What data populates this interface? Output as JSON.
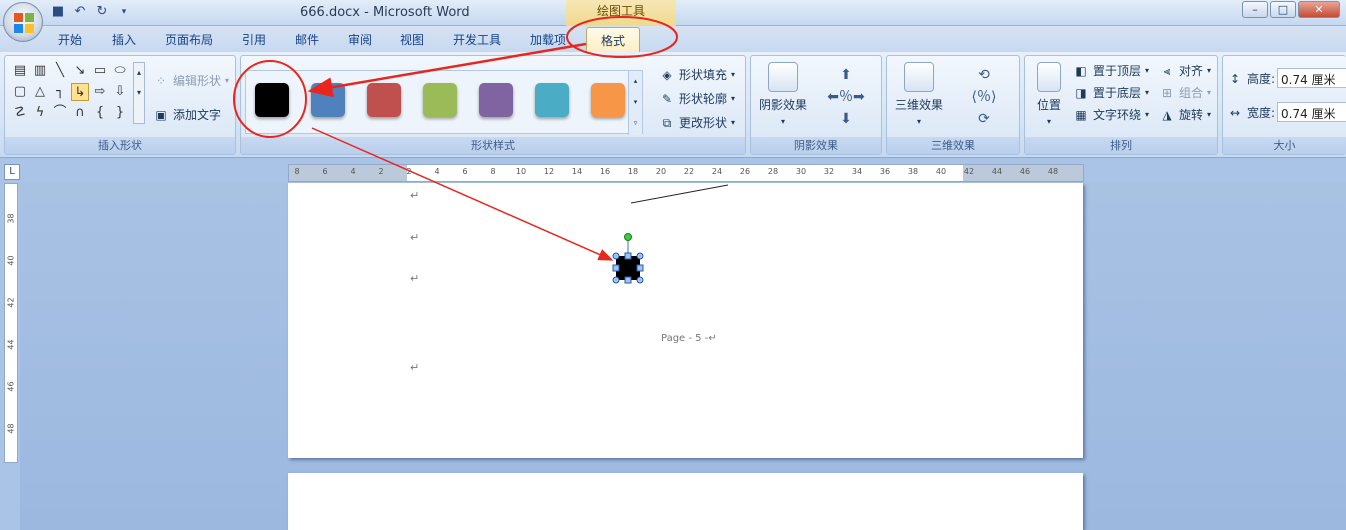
{
  "window": {
    "title": "666.docx - Microsoft Word",
    "context_tab_group": "绘图工具",
    "ghost_titles": [
      "",
      "",
      "",
      ""
    ],
    "controls": {
      "minimize": "–",
      "maximize": "□",
      "close": "✕"
    }
  },
  "quick_access": {
    "save_icon": "save-icon",
    "undo_icon": "undo-icon",
    "redo_icon": "redo-icon"
  },
  "tabs": [
    "开始",
    "插入",
    "页面布局",
    "引用",
    "邮件",
    "审阅",
    "视图",
    "开发工具",
    "加载项",
    "格式"
  ],
  "active_tab": "格式",
  "ribbon": {
    "insert_shapes": {
      "label": "插入形状",
      "edit_shape": "编辑形状",
      "add_text": "添加文字"
    },
    "shape_styles": {
      "label": "形状样式",
      "swatches": [
        "#000000",
        "#4f81bd",
        "#c0504d",
        "#9bbb59",
        "#8064a2",
        "#4bacc6",
        "#f79646"
      ],
      "fill": "形状填充",
      "outline": "形状轮廓",
      "change": "更改形状"
    },
    "shadow_effects": {
      "label": "阴影效果",
      "button": "阴影效果"
    },
    "three_d_effects": {
      "label": "三维效果",
      "button": "三维效果"
    },
    "arrange": {
      "label": "排列",
      "position": "位置",
      "bring_front": "置于顶层",
      "send_back": "置于底层",
      "text_wrap": "文字环绕",
      "align": "对齐",
      "group": "组合",
      "rotate": "旋转"
    },
    "size": {
      "label": "大小",
      "height_label": "高度:",
      "height_value": "0.74 厘米",
      "width_label": "宽度:",
      "width_value": "0.74 厘米"
    }
  },
  "ruler": {
    "corner": "L",
    "h_ticks": [
      "8",
      "6",
      "4",
      "2",
      "2",
      "4",
      "6",
      "8",
      "10",
      "12",
      "14",
      "16",
      "18",
      "20",
      "22",
      "24",
      "26",
      "28",
      "30",
      "32",
      "34",
      "36",
      "38",
      "40",
      "42",
      "44",
      "46",
      "48"
    ],
    "v_ticks": [
      "38",
      "40",
      "42",
      "44",
      "46",
      "48"
    ]
  },
  "document": {
    "para_mark": "↵",
    "footer_text": "Page - 5 -↵"
  },
  "colors": {
    "annotation": "#e8261d",
    "accent": "#f79646"
  }
}
